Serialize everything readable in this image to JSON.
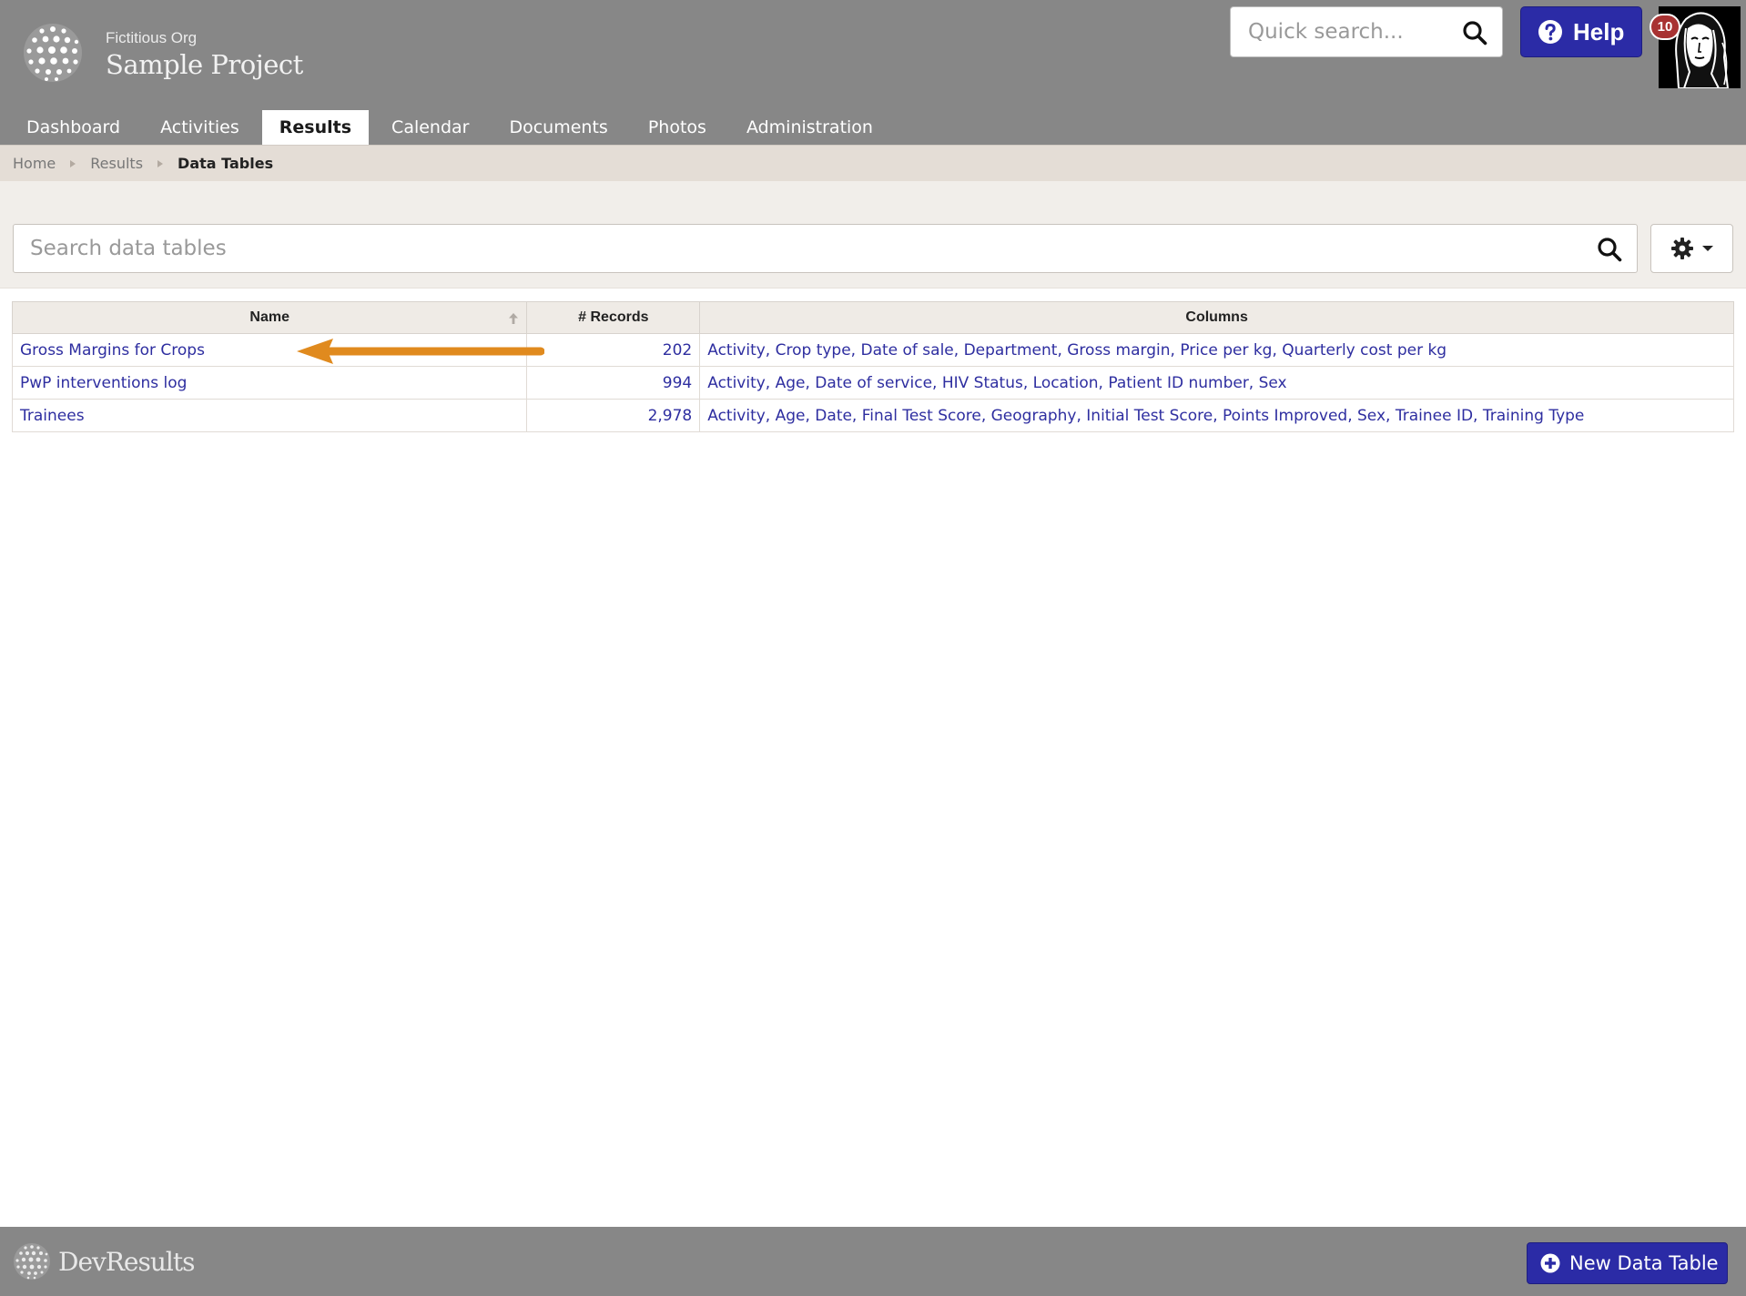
{
  "header": {
    "org_name": "Fictitious Org",
    "project_name": "Sample Project",
    "quick_search_placeholder": "Quick search...",
    "help_label": "Help",
    "notification_count": "10",
    "logo_icon": "globe-logo-icon",
    "brand_color": "#878787",
    "accent_color": "#2b2ba6"
  },
  "nav": {
    "tabs": [
      {
        "label": "Dashboard",
        "active": false
      },
      {
        "label": "Activities",
        "active": false
      },
      {
        "label": "Results",
        "active": true
      },
      {
        "label": "Calendar",
        "active": false
      },
      {
        "label": "Documents",
        "active": false
      },
      {
        "label": "Photos",
        "active": false
      },
      {
        "label": "Administration",
        "active": false
      }
    ]
  },
  "breadcrumb": {
    "items": [
      "Home",
      "Results",
      "Data Tables"
    ]
  },
  "toolbar": {
    "search_placeholder": "Search data tables",
    "settings_icon": "gear-icon"
  },
  "table": {
    "headers": {
      "name": "Name",
      "records": "# Records",
      "columns": "Columns"
    },
    "sort": {
      "column": "Name",
      "direction": "ascending"
    },
    "rows": [
      {
        "name": "Gross Margins for Crops",
        "records": "202",
        "columns": "Activity, Crop type, Date of sale, Department, Gross margin, Price per kg, Quarterly cost per kg"
      },
      {
        "name": "PwP interventions log",
        "records": "994",
        "columns": "Activity, Age, Date of service, HIV Status, Location, Patient ID number, Sex"
      },
      {
        "name": "Trainees",
        "records": "2,978",
        "columns": "Activity, Age, Date, Final Test Score, Geography, Initial Test Score, Points Improved, Sex, Trainee ID, Training Type"
      }
    ]
  },
  "annotation": {
    "arrow_color": "#e08a1e"
  },
  "footer": {
    "brand_prefix": "Dev",
    "brand_suffix": "Results",
    "new_table_label": "New Data Table"
  }
}
